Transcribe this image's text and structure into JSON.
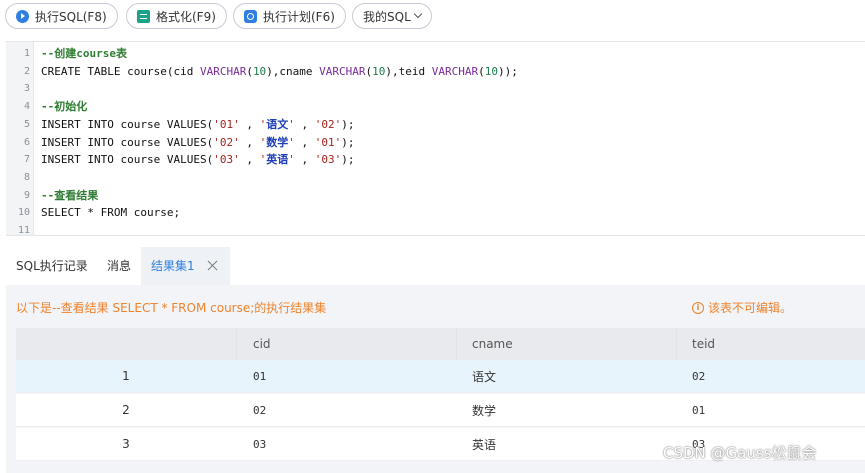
{
  "toolbar": {
    "run_sql": "执行SQL(F8)",
    "format": "格式化(F9)",
    "explain": "执行计划(F6)",
    "my_sql": "我的SQL"
  },
  "editor": {
    "lines": [
      {
        "n": "1",
        "tokens": [
          {
            "t": "--创建course表",
            "c": "comment"
          }
        ]
      },
      {
        "n": "2",
        "tokens": [
          {
            "t": "CREATE TABLE ",
            "c": "kw"
          },
          {
            "t": "course(cid ",
            "c": "plain"
          },
          {
            "t": "VARCHAR",
            "c": "type"
          },
          {
            "t": "(",
            "c": "plain"
          },
          {
            "t": "10",
            "c": "num"
          },
          {
            "t": "),cname ",
            "c": "plain"
          },
          {
            "t": "VARCHAR",
            "c": "type"
          },
          {
            "t": "(",
            "c": "plain"
          },
          {
            "t": "10",
            "c": "num"
          },
          {
            "t": "),teid ",
            "c": "plain"
          },
          {
            "t": "VARCHAR",
            "c": "type"
          },
          {
            "t": "(",
            "c": "plain"
          },
          {
            "t": "10",
            "c": "num"
          },
          {
            "t": "));",
            "c": "plain"
          }
        ]
      },
      {
        "n": "3",
        "tokens": []
      },
      {
        "n": "4",
        "tokens": [
          {
            "t": "--初始化",
            "c": "comment"
          }
        ]
      },
      {
        "n": "5",
        "tokens": [
          {
            "t": "INSERT INTO ",
            "c": "kw"
          },
          {
            "t": "course ",
            "c": "plain"
          },
          {
            "t": "VALUES",
            "c": "kw"
          },
          {
            "t": "(",
            "c": "plain"
          },
          {
            "t": "'01'",
            "c": "str"
          },
          {
            "t": " , ",
            "c": "plain"
          },
          {
            "t": "'",
            "c": "str"
          },
          {
            "t": "语文",
            "c": "cn"
          },
          {
            "t": "'",
            "c": "str"
          },
          {
            "t": " , ",
            "c": "plain"
          },
          {
            "t": "'02'",
            "c": "str"
          },
          {
            "t": ");",
            "c": "plain"
          }
        ]
      },
      {
        "n": "6",
        "tokens": [
          {
            "t": "INSERT INTO ",
            "c": "kw"
          },
          {
            "t": "course ",
            "c": "plain"
          },
          {
            "t": "VALUES",
            "c": "kw"
          },
          {
            "t": "(",
            "c": "plain"
          },
          {
            "t": "'02'",
            "c": "str"
          },
          {
            "t": " , ",
            "c": "plain"
          },
          {
            "t": "'",
            "c": "str"
          },
          {
            "t": "数学",
            "c": "cn"
          },
          {
            "t": "'",
            "c": "str"
          },
          {
            "t": " , ",
            "c": "plain"
          },
          {
            "t": "'01'",
            "c": "str"
          },
          {
            "t": ");",
            "c": "plain"
          }
        ]
      },
      {
        "n": "7",
        "tokens": [
          {
            "t": "INSERT INTO ",
            "c": "kw"
          },
          {
            "t": "course ",
            "c": "plain"
          },
          {
            "t": "VALUES",
            "c": "kw"
          },
          {
            "t": "(",
            "c": "plain"
          },
          {
            "t": "'03'",
            "c": "str"
          },
          {
            "t": " , ",
            "c": "plain"
          },
          {
            "t": "'",
            "c": "str"
          },
          {
            "t": "英语",
            "c": "cn"
          },
          {
            "t": "'",
            "c": "str"
          },
          {
            "t": " , ",
            "c": "plain"
          },
          {
            "t": "'03'",
            "c": "str"
          },
          {
            "t": ");",
            "c": "plain"
          }
        ]
      },
      {
        "n": "8",
        "tokens": []
      },
      {
        "n": "9",
        "tokens": [
          {
            "t": "--查看结果",
            "c": "comment"
          }
        ]
      },
      {
        "n": "10",
        "tokens": [
          {
            "t": "SELECT ",
            "c": "kw"
          },
          {
            "t": "* ",
            "c": "plain"
          },
          {
            "t": "FROM ",
            "c": "kw"
          },
          {
            "t": "course;",
            "c": "plain"
          }
        ]
      },
      {
        "n": "11",
        "tokens": []
      }
    ]
  },
  "tabs": {
    "history": "SQL执行记录",
    "messages": "消息",
    "result": "结果集1"
  },
  "result": {
    "info": "以下是--查看结果 SELECT * FROM course;的执行结果集",
    "readonly_note": "该表不可编辑。",
    "columns": [
      "",
      "cid",
      "cname",
      "teid"
    ],
    "rows": [
      [
        "1",
        "01",
        "语文",
        "02"
      ],
      [
        "2",
        "02",
        "数学",
        "01"
      ],
      [
        "3",
        "03",
        "英语",
        "03"
      ]
    ]
  },
  "watermark": "CSDN @Gauss松鼠会"
}
